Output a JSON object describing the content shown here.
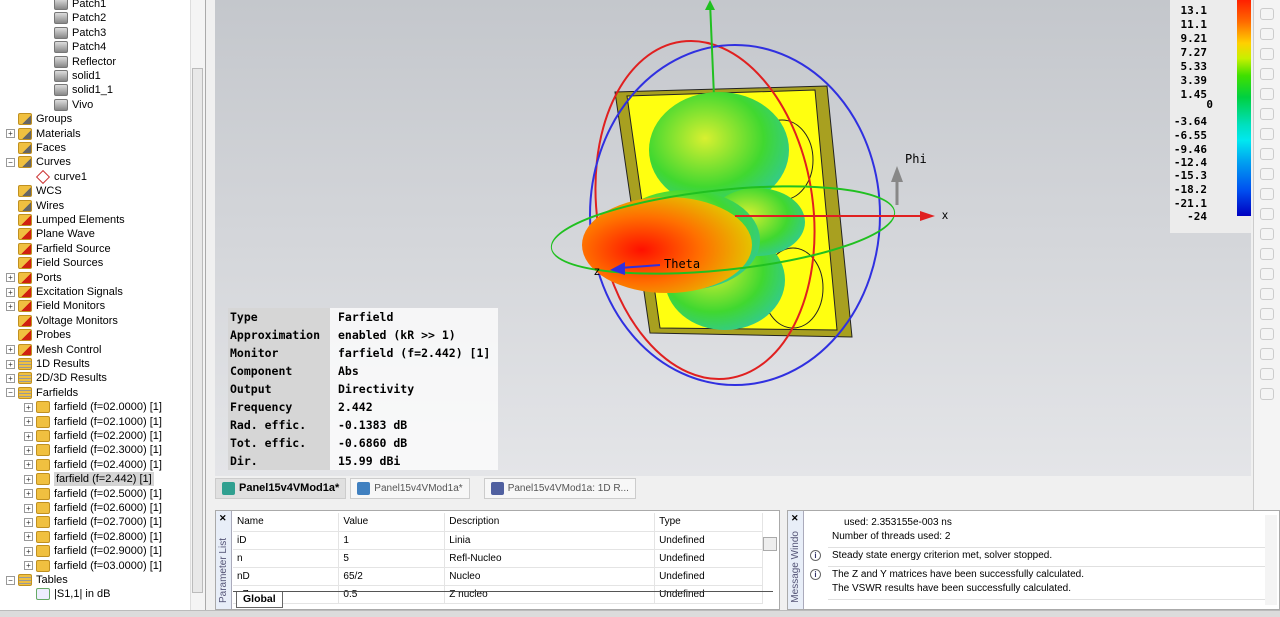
{
  "tree": [
    {
      "label": "Patch1",
      "lvl": 3,
      "icon": "solid"
    },
    {
      "label": "Patch2",
      "lvl": 3,
      "icon": "solid"
    },
    {
      "label": "Patch3",
      "lvl": 3,
      "icon": "solid"
    },
    {
      "label": "Patch4",
      "lvl": 3,
      "icon": "solid"
    },
    {
      "label": "Reflector",
      "lvl": 3,
      "icon": "solid"
    },
    {
      "label": "solid1",
      "lvl": 3,
      "icon": "solid"
    },
    {
      "label": "solid1_1",
      "lvl": 3,
      "icon": "solid"
    },
    {
      "label": "Vivo",
      "lvl": 3,
      "icon": "solid"
    },
    {
      "label": "Groups",
      "lvl": 1,
      "icon": "foldw"
    },
    {
      "label": "Materials",
      "lvl": 1,
      "icon": "foldw",
      "exp": "+"
    },
    {
      "label": "Faces",
      "lvl": 1,
      "icon": "foldw"
    },
    {
      "label": "Curves",
      "lvl": 1,
      "icon": "foldw",
      "exp": "-"
    },
    {
      "label": "curve1",
      "lvl": 2,
      "icon": "curve"
    },
    {
      "label": "WCS",
      "lvl": 1,
      "icon": "foldw"
    },
    {
      "label": "Wires",
      "lvl": 1,
      "icon": "foldw"
    },
    {
      "label": "Lumped Elements",
      "lvl": 1,
      "icon": "foldr"
    },
    {
      "label": "Plane Wave",
      "lvl": 1,
      "icon": "foldr"
    },
    {
      "label": "Farfield Source",
      "lvl": 1,
      "icon": "foldr"
    },
    {
      "label": "Field Sources",
      "lvl": 1,
      "icon": "foldr"
    },
    {
      "label": "Ports",
      "lvl": 1,
      "icon": "foldr",
      "exp": "+"
    },
    {
      "label": "Excitation Signals",
      "lvl": 1,
      "icon": "foldr",
      "exp": "+"
    },
    {
      "label": "Field Monitors",
      "lvl": 1,
      "icon": "foldr",
      "exp": "+"
    },
    {
      "label": "Voltage Monitors",
      "lvl": 1,
      "icon": "foldr"
    },
    {
      "label": "Probes",
      "lvl": 1,
      "icon": "foldr"
    },
    {
      "label": "Mesh Control",
      "lvl": 1,
      "icon": "foldr",
      "exp": "+"
    },
    {
      "label": "1D Results",
      "lvl": 1,
      "icon": "folds",
      "exp": "+"
    },
    {
      "label": "2D/3D Results",
      "lvl": 1,
      "icon": "folds",
      "exp": "+"
    },
    {
      "label": "Farfields",
      "lvl": 1,
      "icon": "folds",
      "exp": "-"
    },
    {
      "label": "farfield (f=02.0000) [1]",
      "lvl": 2,
      "icon": "fold",
      "exp": "+"
    },
    {
      "label": "farfield (f=02.1000) [1]",
      "lvl": 2,
      "icon": "fold",
      "exp": "+"
    },
    {
      "label": "farfield (f=02.2000) [1]",
      "lvl": 2,
      "icon": "fold",
      "exp": "+"
    },
    {
      "label": "farfield (f=02.3000) [1]",
      "lvl": 2,
      "icon": "fold",
      "exp": "+"
    },
    {
      "label": "farfield (f=02.4000) [1]",
      "lvl": 2,
      "icon": "fold",
      "exp": "+"
    },
    {
      "label": "farfield (f=2.442) [1]",
      "lvl": 2,
      "icon": "fold",
      "exp": "+",
      "selected": true
    },
    {
      "label": "farfield (f=02.5000) [1]",
      "lvl": 2,
      "icon": "fold",
      "exp": "+"
    },
    {
      "label": "farfield (f=02.6000) [1]",
      "lvl": 2,
      "icon": "fold",
      "exp": "+"
    },
    {
      "label": "farfield (f=02.7000) [1]",
      "lvl": 2,
      "icon": "fold",
      "exp": "+"
    },
    {
      "label": "farfield (f=02.8000) [1]",
      "lvl": 2,
      "icon": "fold",
      "exp": "+"
    },
    {
      "label": "farfield (f=02.9000) [1]",
      "lvl": 2,
      "icon": "fold",
      "exp": "+"
    },
    {
      "label": "farfield (f=03.0000) [1]",
      "lvl": 2,
      "icon": "fold",
      "exp": "+"
    },
    {
      "label": "Tables",
      "lvl": 1,
      "icon": "folds",
      "exp": "-"
    },
    {
      "label": "|S1,1| in dB",
      "lvl": 2,
      "icon": "table"
    }
  ],
  "info": [
    [
      "Type",
      "Farfield"
    ],
    [
      "Approximation",
      "enabled (kR >> 1)"
    ],
    [
      "Monitor",
      "farfield (f=2.442) [1]"
    ],
    [
      "Component",
      "Abs"
    ],
    [
      "Output",
      "Directivity"
    ],
    [
      "Frequency",
      "2.442"
    ],
    [
      "Rad. effic.",
      "-0.1383 dB"
    ],
    [
      "Tot. effic.",
      "-0.6860 dB"
    ],
    [
      "Dir.",
      " 15.99 dBi"
    ]
  ],
  "axes": {
    "x": "x",
    "z": "z",
    "phi": "Phi",
    "theta": "Theta"
  },
  "legend": [
    "13.1",
    "11.1",
    "9.21",
    "7.27",
    "5.33",
    "3.39",
    "1.45",
    "0",
    "-3.64",
    "-6.55",
    "-9.46",
    "-12.4",
    "-15.3",
    "-18.2",
    "-21.1",
    "-24"
  ],
  "tabs": [
    "Panel15v4VMod1a*",
    "Panel15v4VMod1a*",
    "Panel15v4VMod1a: 1D R..."
  ],
  "param": {
    "title": "Parameter List",
    "headers": [
      "Name",
      "Value",
      "Description",
      "Type"
    ],
    "rows": [
      [
        "iD",
        "1",
        "Linia",
        "Undefined"
      ],
      [
        "n",
        "5",
        "Refl-Nucleo",
        "Undefined"
      ],
      [
        "nD",
        "65/2",
        "Nucleo",
        "Undefined"
      ],
      [
        "nZ",
        "0.5",
        "Z nucleo",
        "Undefined"
      ]
    ],
    "tab": "Global"
  },
  "msg": {
    "title": "Message Windo",
    "lines": [
      "used: 2.353155e-003 ns",
      "Number of threads used: 2",
      "Steady state energy criterion met, solver stopped.",
      "The Z and Y matrices have been successfully calculated.",
      "The VSWR results have been successfully calculated."
    ]
  }
}
